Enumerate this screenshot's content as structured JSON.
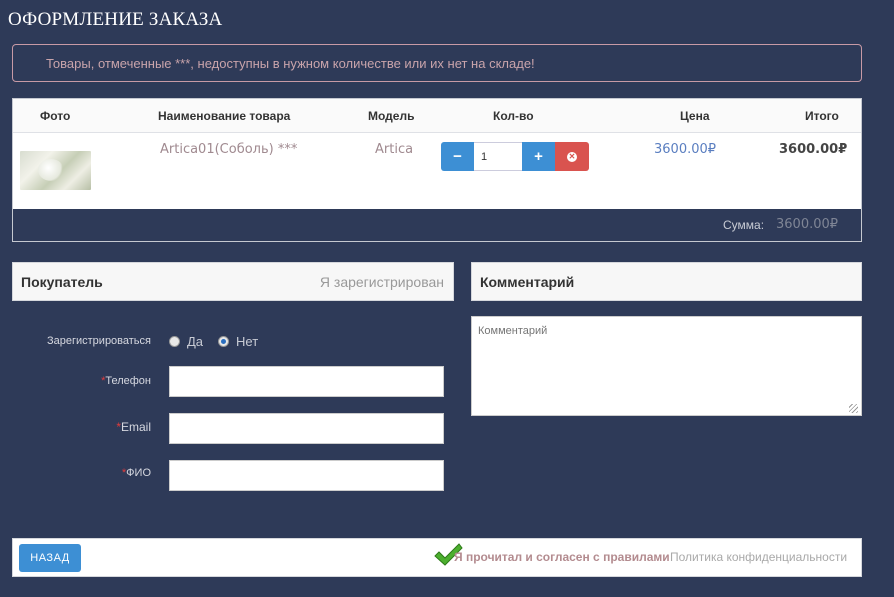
{
  "page": {
    "title": "ОФОРМЛЕНИЕ ЗАКАЗА"
  },
  "alert": {
    "text": "Товары, отмеченные ***, недоступны в нужном количестве или их нет на складе!"
  },
  "cart": {
    "columns": [
      "Фото",
      "Наименование товара",
      "Модель",
      "Кол-во",
      "Цена",
      "Итого"
    ],
    "items": [
      {
        "name": "Artica01(Соболь) ***",
        "model": "Artica",
        "quantity": "1",
        "price": "3600.00₽",
        "total": "3600.00₽"
      }
    ],
    "sum_label": "Сумма:",
    "sum_value": "3600.00₽"
  },
  "qty_controls": {
    "minus": "−",
    "plus": "+",
    "delete": "✕"
  },
  "buyer": {
    "title": "Покупатель",
    "login_link": "Я зарегистрирован",
    "register_label": "Зарегистрироваться",
    "register_options": [
      "Да",
      "Нет"
    ],
    "register_selected": "Нет",
    "fields": [
      {
        "label": "Телефон",
        "required_mark": "*",
        "value": ""
      },
      {
        "label": "Email",
        "required_mark": "*",
        "value": ""
      },
      {
        "label": "ФИО",
        "required_mark": "*",
        "value": ""
      }
    ]
  },
  "comment": {
    "title": "Комментарий",
    "placeholder": "Комментарий"
  },
  "footer": {
    "back_button": "НАЗАД",
    "agree_text": "Я прочитал и согласен с правилами",
    "policy_link": "Политика конфиденциальности"
  },
  "colors": {
    "background": "#2e3a58",
    "primary_button": "#3d8fd4",
    "danger_button": "#d9534f",
    "required_mark": "#e23b3b",
    "check_mark": "#4caf2e"
  }
}
